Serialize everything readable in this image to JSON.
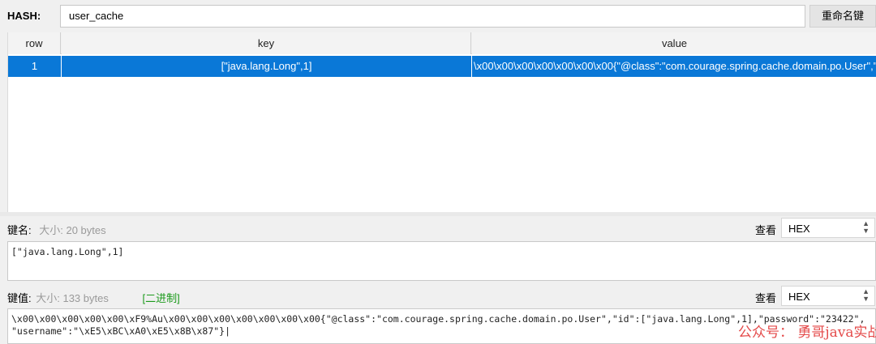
{
  "header": {
    "hash_label": "HASH:",
    "hash_value": "user_cache",
    "rename_label": "重命名键"
  },
  "table": {
    "columns": [
      "row",
      "key",
      "value"
    ],
    "rows": [
      {
        "row": "1",
        "key": "[\"java.lang.Long\",1]",
        "value": "\\x00\\x00\\x00\\x00\\x00\\x00\\x00{\"@class\":\"com.courage.spring.cache.domain.po.User\",\""
      }
    ]
  },
  "key_section": {
    "label": "键名:",
    "size_text": "大小: 20 bytes",
    "view_label": "查看",
    "format": "HEX",
    "content": "[\"java.lang.Long\",1]"
  },
  "value_section": {
    "label": "键值:",
    "size_text": "大小: 133 bytes",
    "binary_tag": "[二进制]",
    "view_label": "查看",
    "format": "HEX",
    "content_line1": "\\x00\\x00\\x00\\x00\\x00\\xF9%Au\\x00\\x00\\x00\\x00\\x00\\x00\\x00{\"@class\":\"com.courage.spring.cache.domain.po.User\",\"id\":[\"java.lang.Long\",1],\"password\":\"23422\",",
    "content_line2": "\"username\":\"\\xE5\\xBC\\xA0\\xE5\\x8B\\x87\"}|"
  },
  "watermark": "公众号：  勇哥java实战分享"
}
